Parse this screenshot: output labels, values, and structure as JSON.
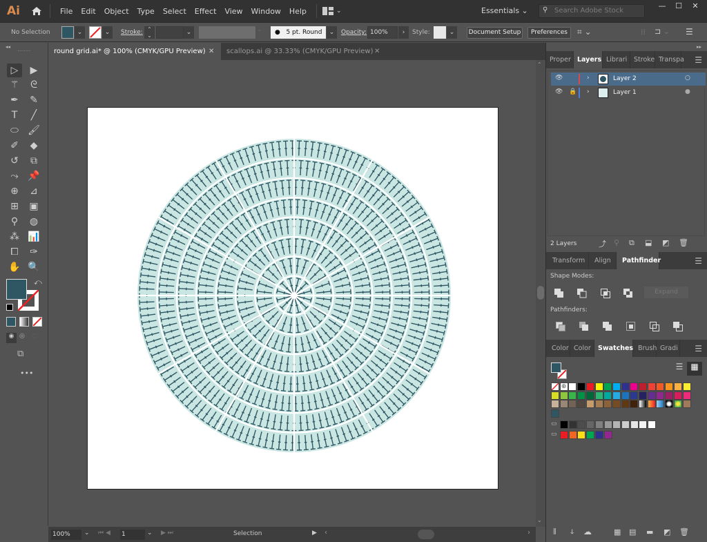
{
  "app": {
    "logo": "Ai",
    "workspace": "Essentials",
    "search_placeholder": "Search Adobe Stock"
  },
  "menu": [
    "File",
    "Edit",
    "Object",
    "Type",
    "Select",
    "Effect",
    "View",
    "Window",
    "Help"
  ],
  "window_controls": {
    "minimize": "—",
    "maximize": "☐",
    "close": "✕"
  },
  "control_bar": {
    "selection": "No Selection",
    "fill_color": "#2f5763",
    "stroke_label": "Stroke:",
    "stroke_value": "",
    "brush": "5 pt. Round",
    "opacity_label": "Opacity:",
    "opacity_value": "100%",
    "style_label": "Style:",
    "document_setup": "Document Setup",
    "preferences": "Preferences"
  },
  "doc_tabs": [
    {
      "label": "round grid.ai* @ 100% (CMYK/GPU Preview)",
      "active": true
    },
    {
      "label": "scallops.ai @ 33.33% (CMYK/GPU Preview)",
      "active": false
    }
  ],
  "artwork": {
    "fill": "#c9e6e3",
    "stitch_color": "#2f5763",
    "divider_color": "#ffffff",
    "rings": 8,
    "spokes": 12
  },
  "status": {
    "zoom": "100%",
    "artboard": "1",
    "tool": "Selection"
  },
  "panels": {
    "top_tabs": [
      "Proper",
      "Layers",
      "Librari",
      "Stroke",
      "Transpa"
    ],
    "top_active": 1,
    "layers": [
      {
        "name": "Layer 2",
        "color": "#e0474c",
        "selected": true,
        "locked": false
      },
      {
        "name": "Layer 1",
        "color": "#4a7fe0",
        "selected": false,
        "locked": true
      }
    ],
    "layer_count": "2 Layers",
    "mid_tabs": [
      "Transform",
      "Align",
      "Pathfinder"
    ],
    "mid_active": 2,
    "shape_modes_label": "Shape Modes:",
    "expand_label": "Expand",
    "pathfinders_label": "Pathfinders:",
    "bottom_tabs": [
      "Color",
      "Color",
      "Swatches",
      "Brush",
      "Gradi"
    ],
    "bottom_active": 2,
    "swatches": {
      "row1": [
        "none",
        "reg",
        "#ffffff",
        "#000000",
        "#ed1c24",
        "#fff200",
        "#00a651",
        "#00aeef",
        "#2e3192",
        "#ec008c",
        "#be1e2d",
        "#ef4136",
        "#f15a24",
        "#f7941d",
        "#fbb040",
        "#f9ed32"
      ],
      "row2": [
        "#d7df23",
        "#8dc63f",
        "#39b54a",
        "#009444",
        "#006838",
        "#2bb673",
        "#00a99d",
        "#27aae1",
        "#1c75bc",
        "#2b3990",
        "#262262",
        "#662d91",
        "#92278f",
        "#9e1f63",
        "#da1c5c",
        "#ee2a7b"
      ],
      "row3": [
        "#c7b299",
        "#998675",
        "#736357",
        "#534741",
        "#c69c6d",
        "#a67c52",
        "#8c6239",
        "#754c24",
        "#603813",
        "#42210b",
        "grad1",
        "grad2",
        "grad3",
        "pat1",
        "pat2",
        "pat3"
      ],
      "row4": [
        "#2f5763"
      ],
      "grays": [
        "#000000",
        "#333333",
        "#4d4d4d",
        "#666666",
        "#808080",
        "#999999",
        "#b3b3b3",
        "#cccccc",
        "#e6e6e6",
        "#f2f2f2",
        "#ffffff"
      ],
      "brights": [
        "#ed1c24",
        "#f26522",
        "#ffde17",
        "#00a651",
        "#2e3192",
        "#92278f"
      ]
    }
  }
}
